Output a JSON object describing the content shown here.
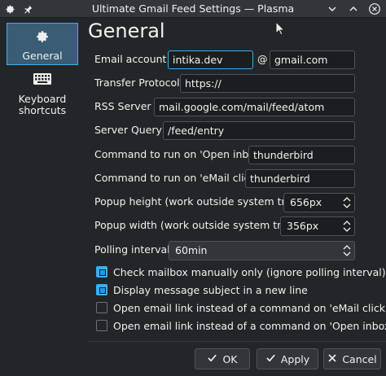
{
  "window": {
    "title": "Ultimate Gmail Feed Settings — Plasma"
  },
  "sidebar": {
    "items": [
      {
        "label": "General",
        "icon": "gear-icon",
        "active": true
      },
      {
        "label": "Keyboard shortcuts",
        "label_line1": "Keyboard",
        "label_line2": "shortcuts",
        "icon": "keyboard-icon",
        "active": false
      }
    ]
  },
  "page": {
    "heading": "General"
  },
  "form": {
    "email_label": "Email account :",
    "email_user": "intika.dev",
    "email_at": "@",
    "email_domain": "gmail.com",
    "protocol_label": "Transfer Protocol :",
    "protocol_value": "https://",
    "rss_label": "RSS Server :",
    "rss_value": "mail.google.com/mail/feed/atom",
    "query_label": "Server Query :",
    "query_value": "/feed/entry",
    "open_inbox_label": "Command to run on 'Open inbox' :",
    "open_inbox_value": "thunderbird",
    "email_click_label": "Command to run on 'eMail click' :",
    "email_click_value": "thunderbird",
    "popup_height_label": "Popup height (work outside system tray) :",
    "popup_height_value": "656px",
    "popup_width_label": "Popup width (work outside system tray) :",
    "popup_width_value": "356px",
    "polling_label": "Polling interval :",
    "polling_value": "60min"
  },
  "checkboxes": [
    {
      "label": "Check mailbox manually only (ignore polling interval)",
      "checked": true
    },
    {
      "label": "Display message subject in a new line",
      "checked": true
    },
    {
      "label": "Open email link instead of a command on 'eMail click'",
      "checked": false
    },
    {
      "label": "Open email link instead of a command on 'Open inbox'",
      "checked": false
    }
  ],
  "buttons": {
    "ok": "OK",
    "apply": "Apply",
    "cancel": "Cancel"
  },
  "colors": {
    "accent": "#3daee9",
    "background": "#232629",
    "sidebar_active": "#3a5d75"
  }
}
